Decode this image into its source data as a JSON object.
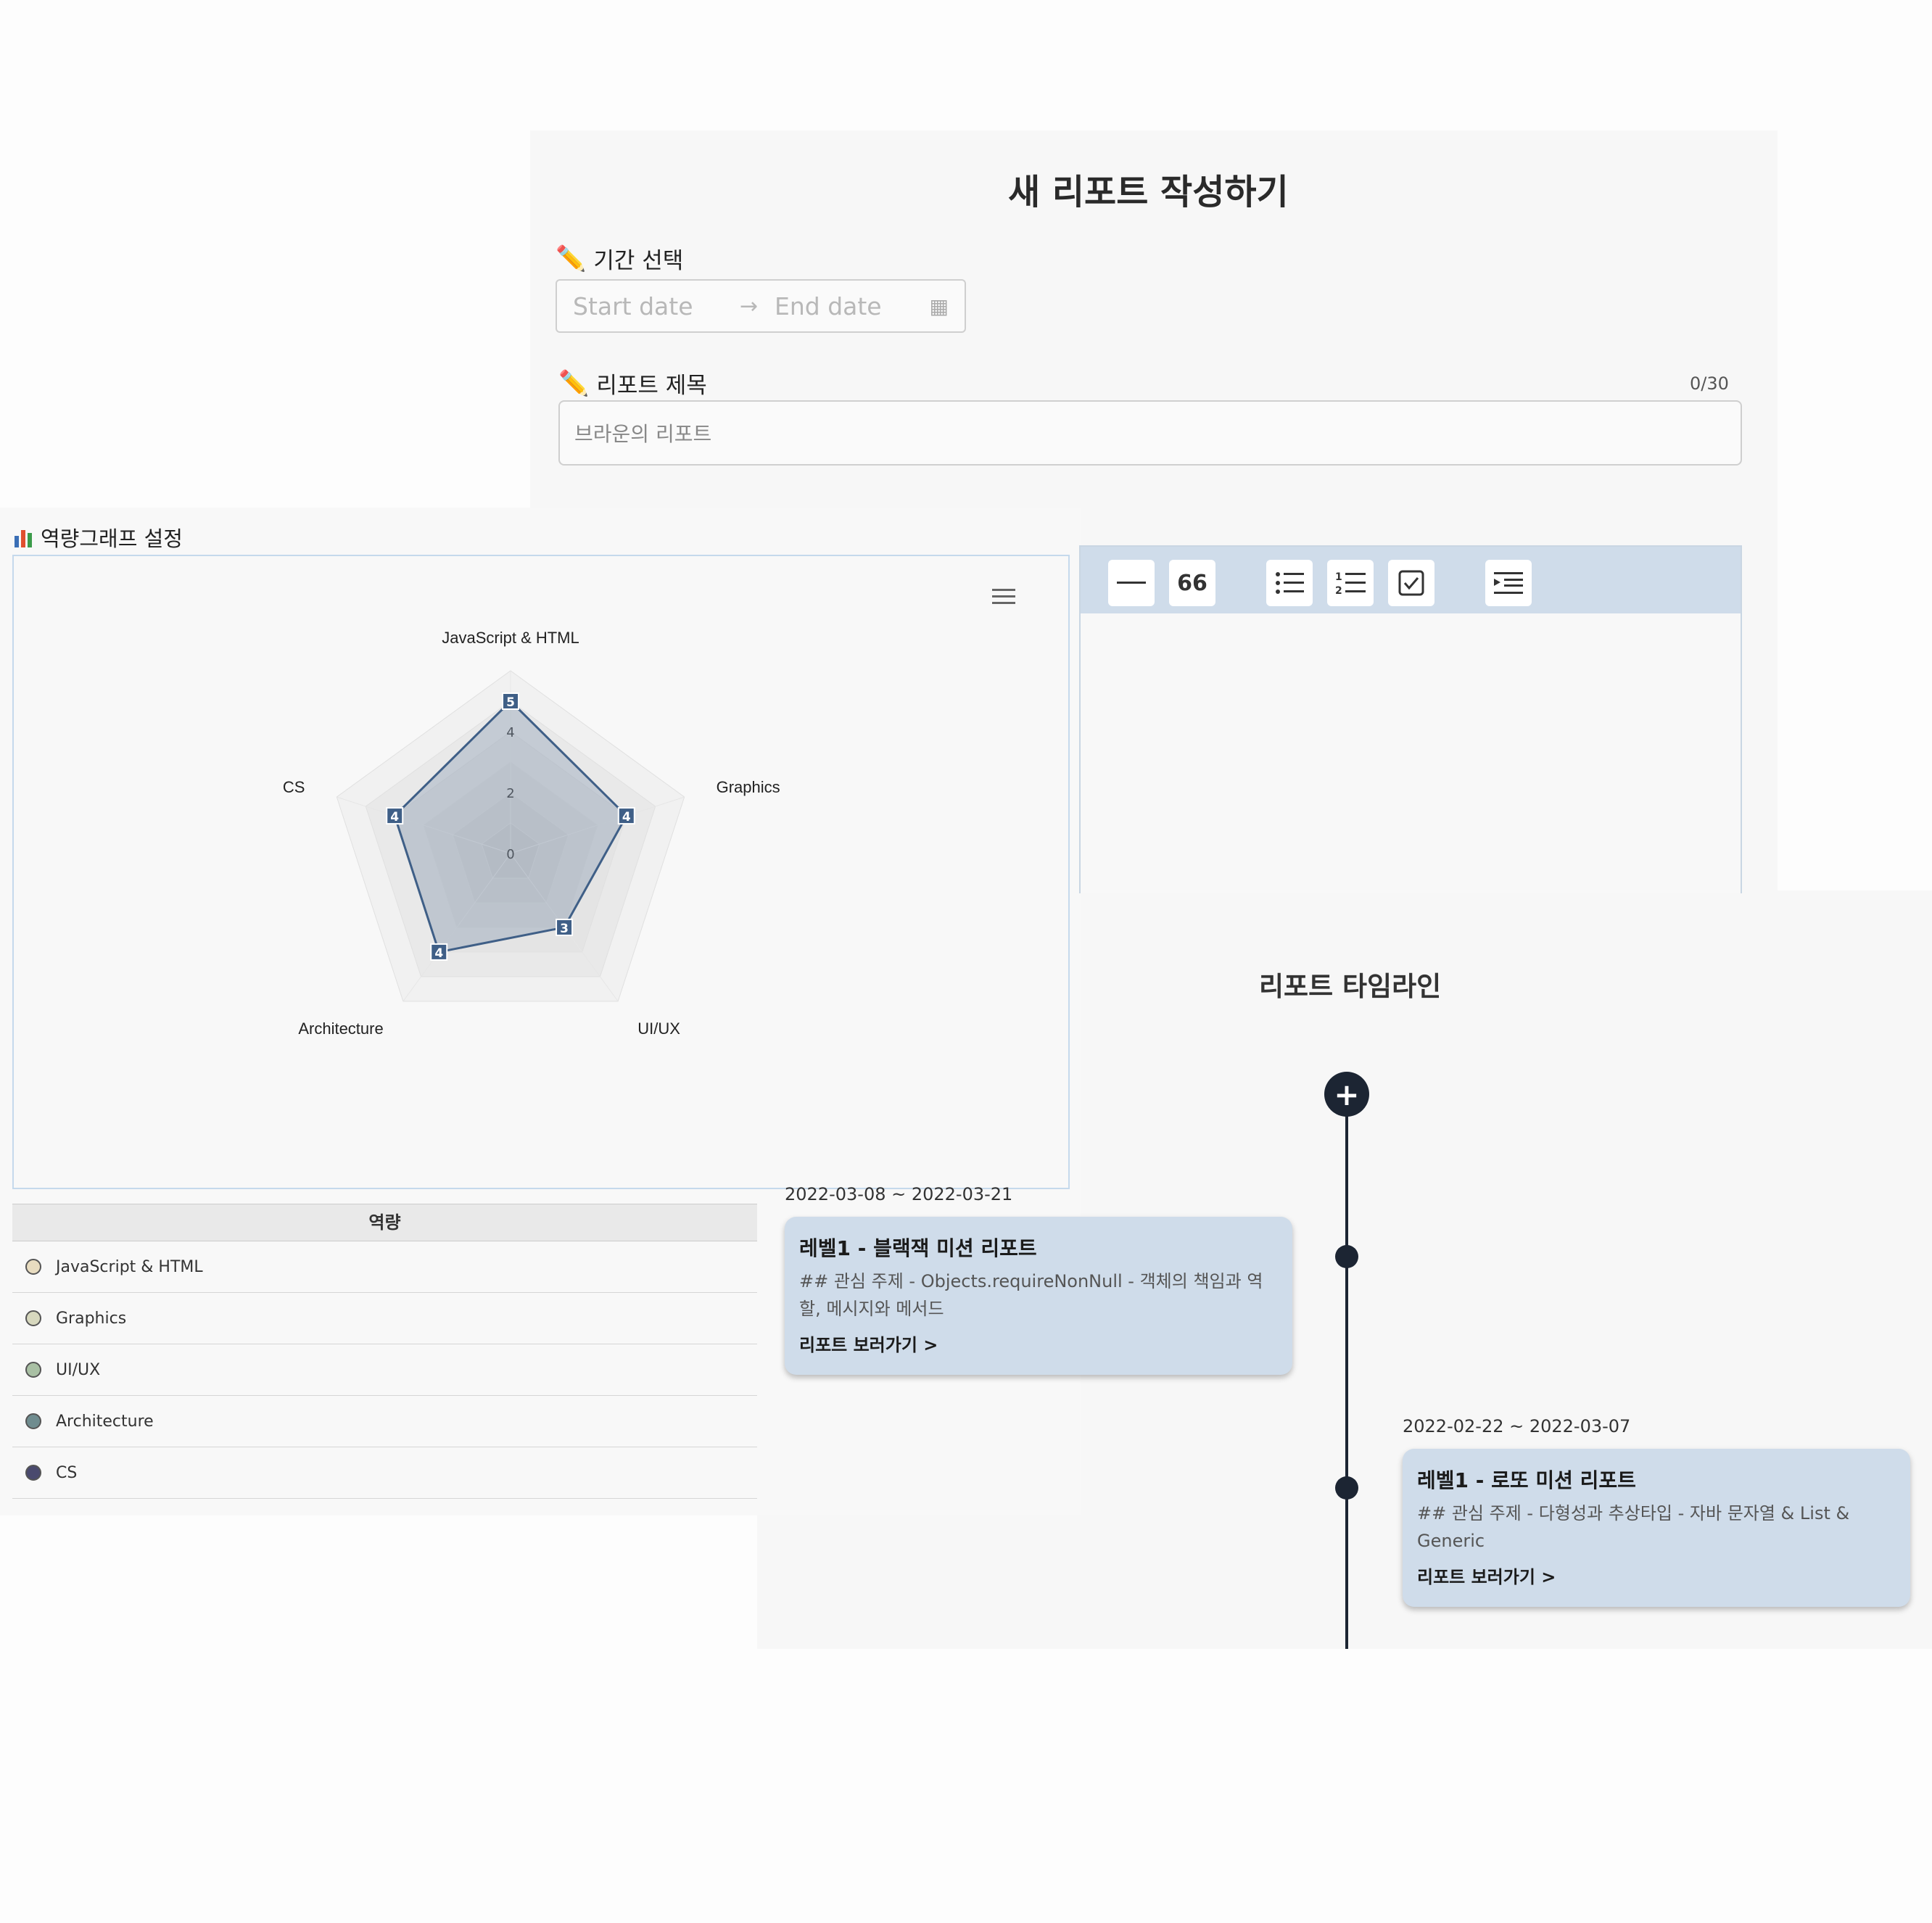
{
  "form": {
    "title": "새 리포트 작성하기",
    "period_label": "기간 선택",
    "start_placeholder": "Start date",
    "end_placeholder": "End date",
    "report_title_label": "리포트 제목",
    "report_title_counter": "0/30",
    "report_title_placeholder": "브라운의 리포트"
  },
  "editor": {
    "toolbar": [
      "horizontal-rule",
      "blockquote",
      "bullet-list",
      "ordered-list",
      "task-list",
      "indent"
    ],
    "quote_label": "66"
  },
  "chart_section": {
    "label": "역량그래프 설정",
    "table_header": "역량",
    "skills": [
      {
        "name": "JavaScript & HTML",
        "color": "#e8dcc0"
      },
      {
        "name": "Graphics",
        "color": "#d7d8be"
      },
      {
        "name": "UI/UX",
        "color": "#a9c0a4"
      },
      {
        "name": "Architecture",
        "color": "#6f8c8f"
      },
      {
        "name": "CS",
        "color": "#4a4a6e"
      }
    ]
  },
  "chart_data": {
    "type": "radar",
    "categories": [
      "JavaScript & HTML",
      "Graphics",
      "UI/UX",
      "Architecture",
      "CS"
    ],
    "series": [
      {
        "values": [
          5,
          4,
          3,
          4,
          4
        ]
      }
    ],
    "rlim": [
      0,
      5
    ],
    "ticks": [
      "0",
      "2",
      "4",
      "5"
    ],
    "grid": true,
    "series_color": "#3f5f87"
  },
  "timeline": {
    "title": "리포트 타임라인",
    "items": [
      {
        "date": "2022-03-08 ~ 2022-03-21",
        "title": "레벨1 - 블랙잭 미션 리포트",
        "body": "## 관심 주제 - Objects.requireNonNull - 객체의 책임과 역할, 메시지와 메서드",
        "link": "리포트 보러가기 >"
      },
      {
        "date": "2022-02-22 ~ 2022-03-07",
        "title": "레벨1 - 로또 미션 리포트",
        "body": "## 관심 주제 - 다형성과 추상타입 - 자바 문자열 & List & Generic",
        "link": "리포트 보러가기 >"
      }
    ]
  }
}
